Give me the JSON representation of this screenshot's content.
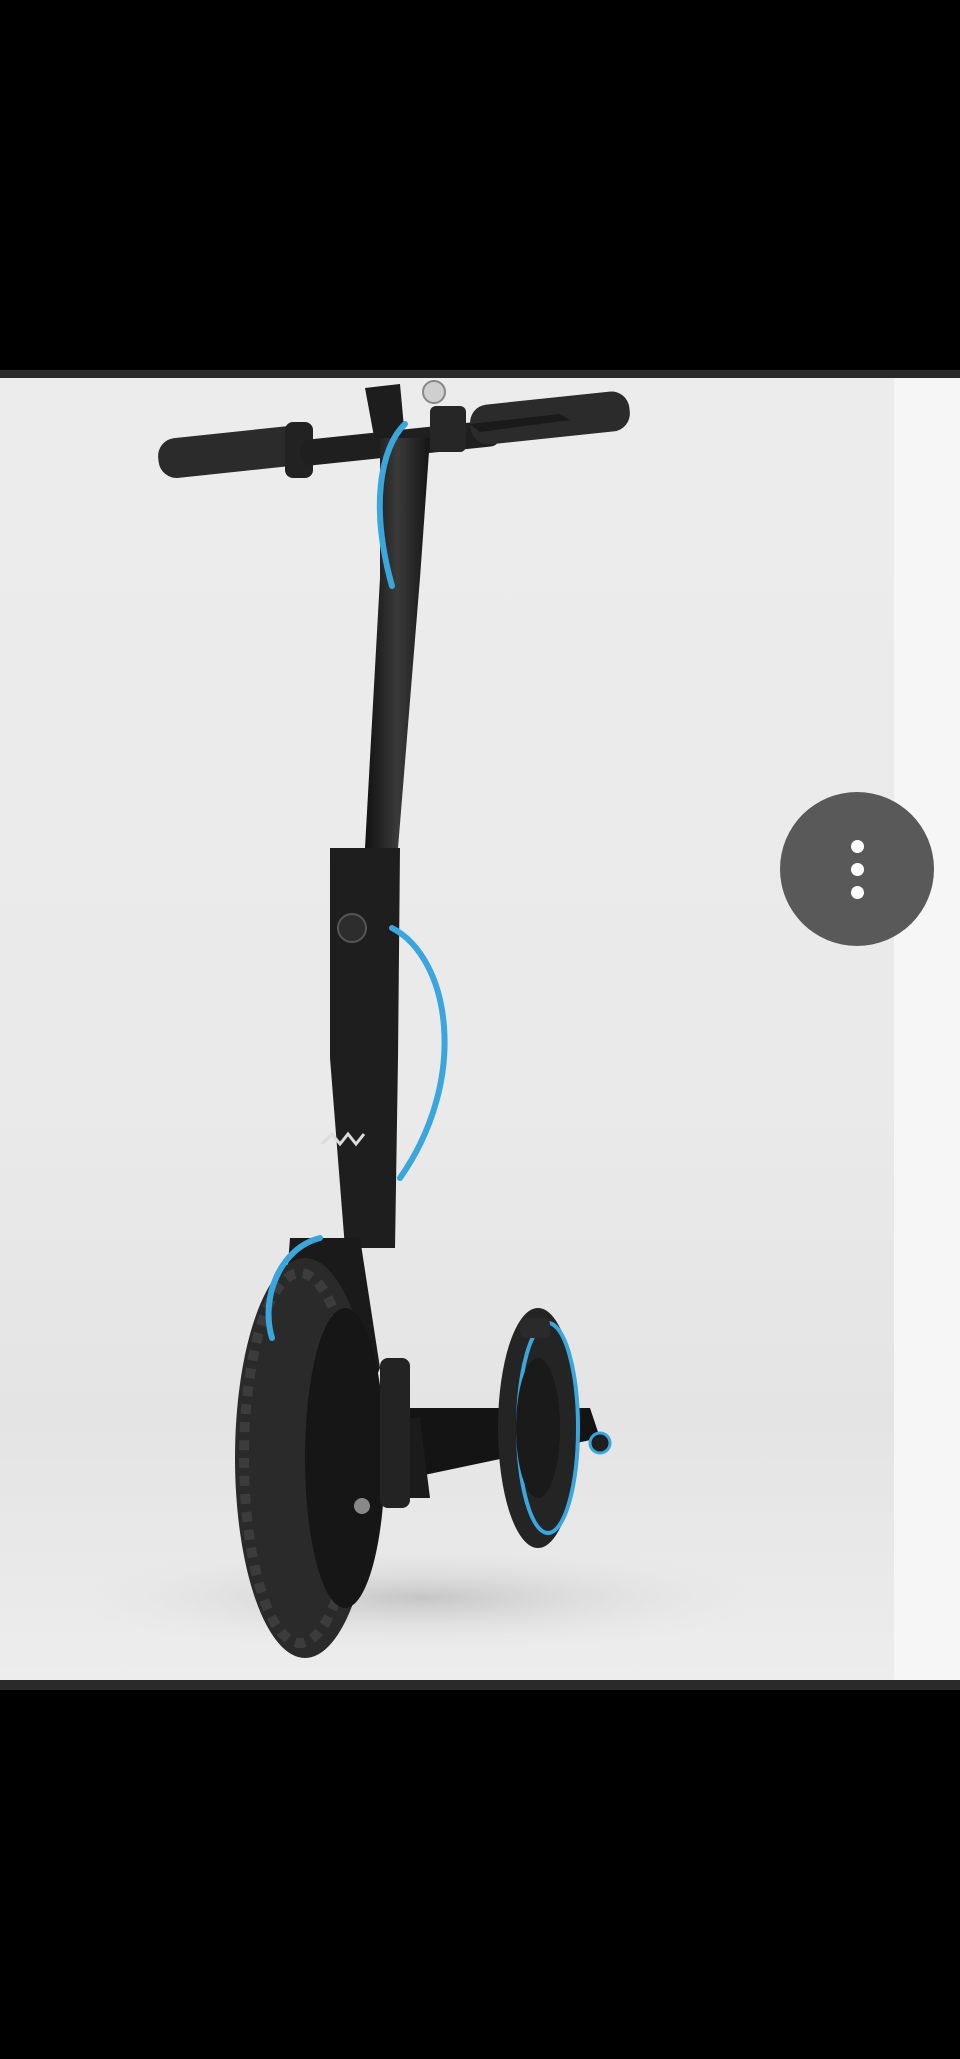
{
  "viewer": {
    "image_subject": "electric-scooter-photo",
    "more_options_icon": "more-vert-icon"
  },
  "colors": {
    "background": "#000000",
    "photo_background": "#ececec",
    "scooter_body": "#1c1c1c",
    "cable_accent": "#3aa6dc",
    "button_background": "#595959"
  }
}
